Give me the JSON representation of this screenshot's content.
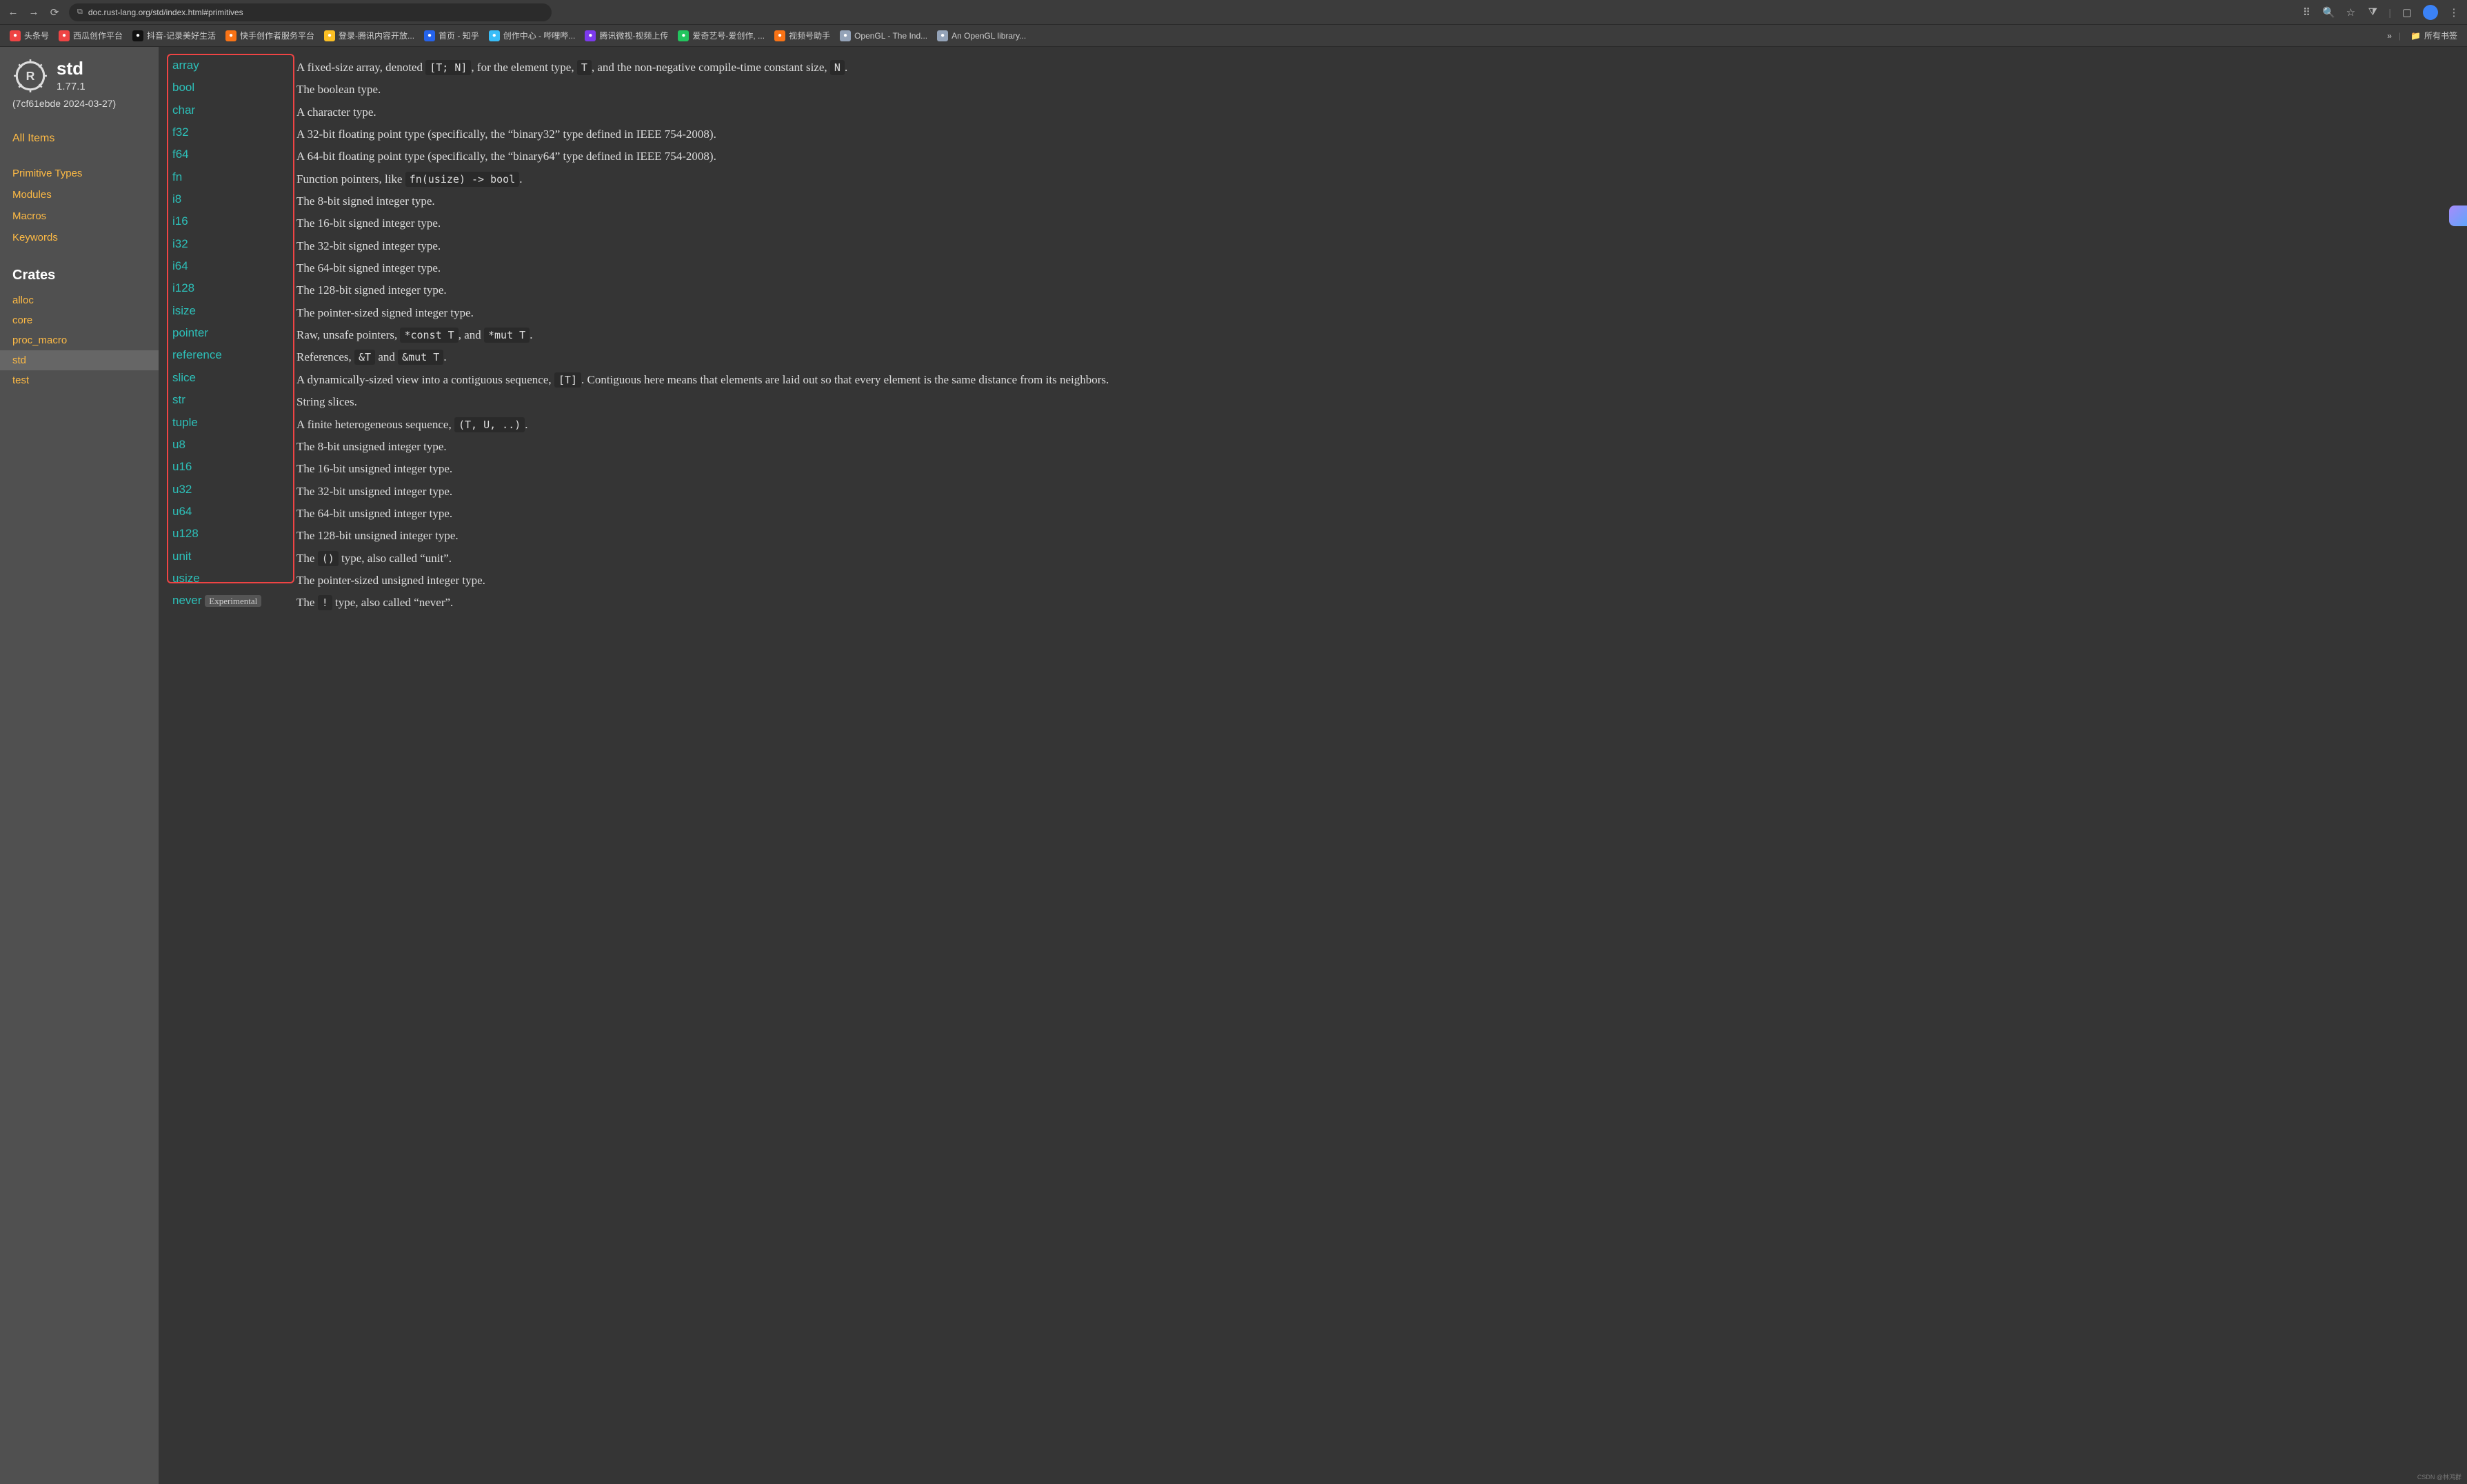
{
  "browser": {
    "url": "doc.rust-lang.org/std/index.html#primitives"
  },
  "bookmarks": [
    {
      "label": "头条号",
      "color": "#ef4444"
    },
    {
      "label": "西瓜创作平台",
      "color": "#ef4444"
    },
    {
      "label": "抖音-记录美好生活",
      "color": "#111"
    },
    {
      "label": "快手创作者服务平台",
      "color": "#f97316"
    },
    {
      "label": "登录-腾讯内容开放...",
      "color": "#fbbf24"
    },
    {
      "label": "首页 - 知乎",
      "color": "#2563eb"
    },
    {
      "label": "创作中心 - 哔哩哔...",
      "color": "#38bdf8"
    },
    {
      "label": "腾讯微视-视频上传",
      "color": "#7c3aed"
    },
    {
      "label": "爱奇艺号-爱创作, ...",
      "color": "#22c55e"
    },
    {
      "label": "视频号助手",
      "color": "#f97316"
    },
    {
      "label": "OpenGL - The Ind...",
      "color": "#94a3b8"
    },
    {
      "label": "An OpenGL library...",
      "color": "#94a3b8"
    }
  ],
  "bookmarks_right": {
    "more": "»",
    "folder": "所有书签"
  },
  "sidebar": {
    "title": "std",
    "version": "1.77.1",
    "commit": "(7cf61ebde 2024-03-27)",
    "all_items": "All Items",
    "sections": [
      "Primitive Types",
      "Modules",
      "Macros",
      "Keywords"
    ],
    "crates_heading": "Crates",
    "crates": [
      "alloc",
      "core",
      "proc_macro",
      "std",
      "test"
    ],
    "active_crate": "std"
  },
  "primitives": [
    {
      "name": "array",
      "desc_parts": [
        "A fixed-size array, denoted ",
        {
          "code": "[T; N]"
        },
        ", for the element type, ",
        {
          "code": "T"
        },
        ", and the non-negative compile-time constant size, ",
        {
          "code": "N"
        },
        "."
      ]
    },
    {
      "name": "bool",
      "desc_parts": [
        "The boolean type."
      ]
    },
    {
      "name": "char",
      "desc_parts": [
        "A character type."
      ]
    },
    {
      "name": "f32",
      "desc_parts": [
        "A 32-bit floating point type (specifically, the “binary32” type defined in IEEE 754-2008)."
      ]
    },
    {
      "name": "f64",
      "desc_parts": [
        "A 64-bit floating point type (specifically, the “binary64” type defined in IEEE 754-2008)."
      ]
    },
    {
      "name": "fn",
      "desc_parts": [
        "Function pointers, like ",
        {
          "code": "fn(usize) -> bool"
        },
        "."
      ]
    },
    {
      "name": "i8",
      "desc_parts": [
        "The 8-bit signed integer type."
      ]
    },
    {
      "name": "i16",
      "desc_parts": [
        "The 16-bit signed integer type."
      ]
    },
    {
      "name": "i32",
      "desc_parts": [
        "The 32-bit signed integer type."
      ]
    },
    {
      "name": "i64",
      "desc_parts": [
        "The 64-bit signed integer type."
      ]
    },
    {
      "name": "i128",
      "desc_parts": [
        "The 128-bit signed integer type."
      ]
    },
    {
      "name": "isize",
      "desc_parts": [
        "The pointer-sized signed integer type."
      ]
    },
    {
      "name": "pointer",
      "desc_parts": [
        "Raw, unsafe pointers, ",
        {
          "code": "*const T"
        },
        ", and ",
        {
          "code": "*mut T"
        },
        "."
      ]
    },
    {
      "name": "reference",
      "desc_parts": [
        "References, ",
        {
          "code": "&T"
        },
        " and ",
        {
          "code": "&mut T"
        },
        "."
      ]
    },
    {
      "name": "slice",
      "desc_parts": [
        "A dynamically-sized view into a contiguous sequence, ",
        {
          "code": "[T]"
        },
        ". Contiguous here means that elements are laid out so that every element is the same distance from its neighbors."
      ]
    },
    {
      "name": "str",
      "desc_parts": [
        "String slices."
      ]
    },
    {
      "name": "tuple",
      "desc_parts": [
        "A finite heterogeneous sequence, ",
        {
          "code": "(T, U, ..)"
        },
        "."
      ]
    },
    {
      "name": "u8",
      "desc_parts": [
        "The 8-bit unsigned integer type."
      ]
    },
    {
      "name": "u16",
      "desc_parts": [
        "The 16-bit unsigned integer type."
      ]
    },
    {
      "name": "u32",
      "desc_parts": [
        "The 32-bit unsigned integer type."
      ]
    },
    {
      "name": "u64",
      "desc_parts": [
        "The 64-bit unsigned integer type."
      ]
    },
    {
      "name": "u128",
      "desc_parts": [
        "The 128-bit unsigned integer type."
      ]
    },
    {
      "name": "unit",
      "desc_parts": [
        "The ",
        {
          "code": "()"
        },
        " type, also called “unit”."
      ]
    },
    {
      "name": "usize",
      "desc_parts": [
        "The pointer-sized unsigned integer type."
      ]
    },
    {
      "name": "never",
      "badge": "Experimental",
      "desc_parts": [
        "The ",
        {
          "code": "!"
        },
        " type, also called “never”."
      ]
    }
  ],
  "watermark": "CSDN @林鸿群"
}
